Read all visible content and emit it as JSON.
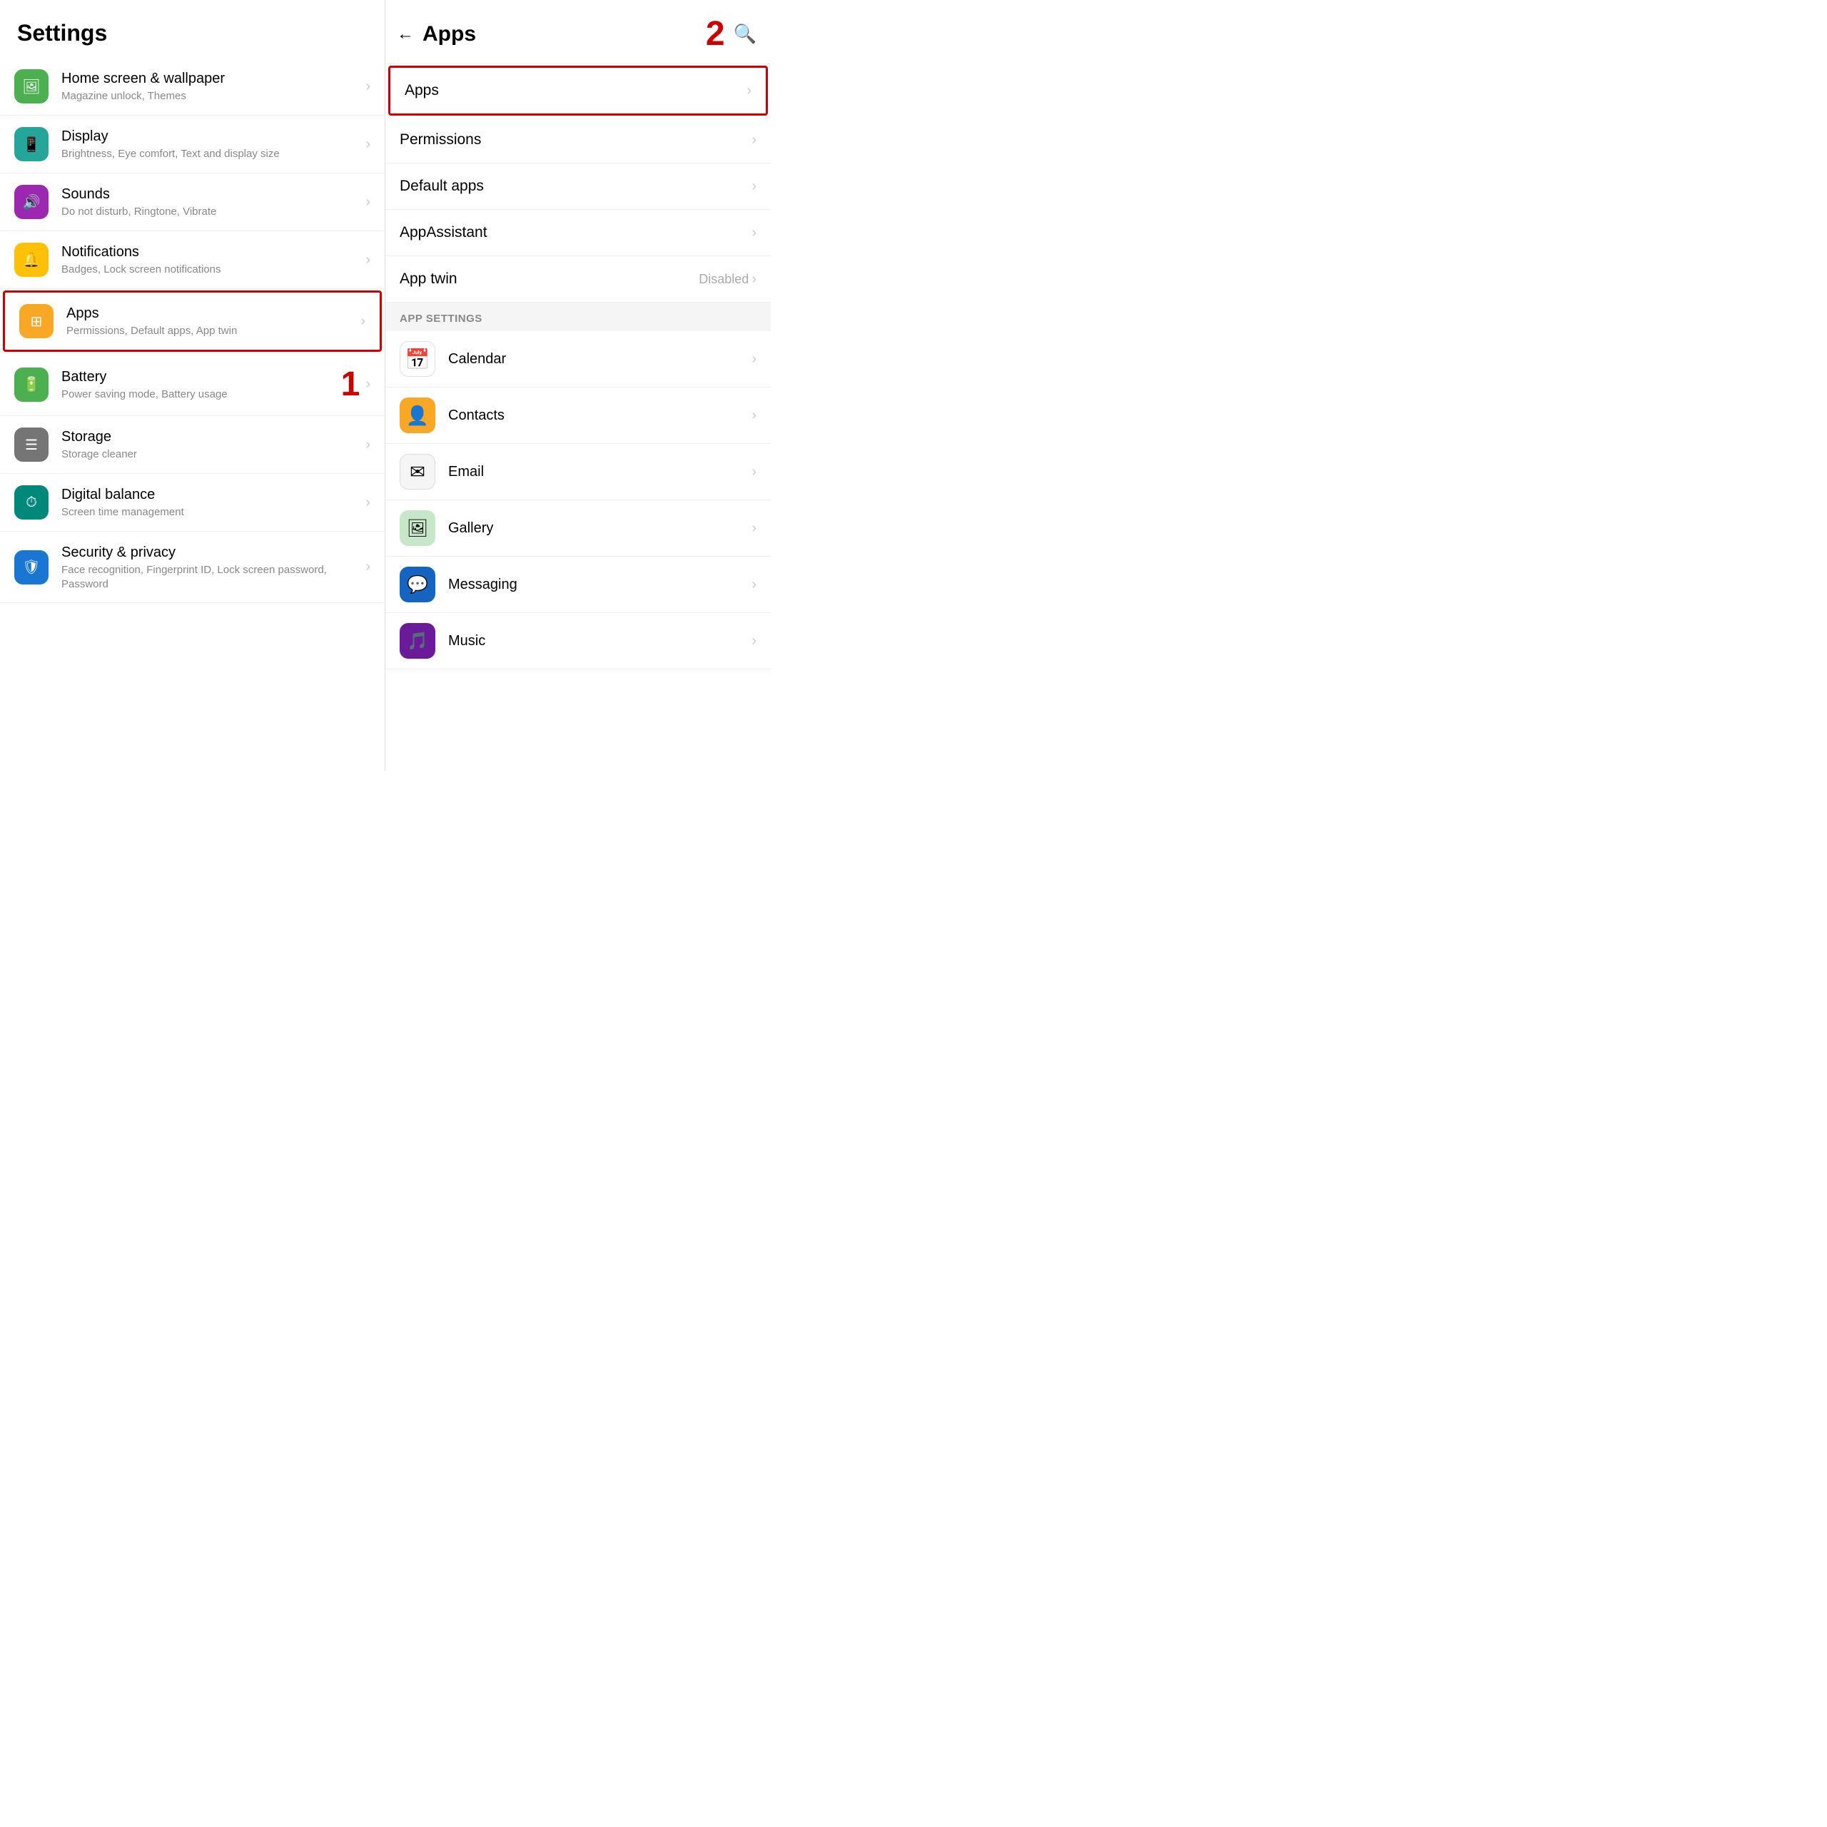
{
  "left": {
    "title": "Settings",
    "items": [
      {
        "icon_color": "icon-green",
        "icon_symbol": "🖼",
        "title": "Home screen & wallpaper",
        "subtitle": "Magazine unlock, Themes"
      },
      {
        "icon_color": "icon-teal",
        "icon_symbol": "📱",
        "title": "Display",
        "subtitle": "Brightness, Eye comfort, Text and display size"
      },
      {
        "icon_color": "icon-purple",
        "icon_symbol": "🔊",
        "title": "Sounds",
        "subtitle": "Do not disturb, Ringtone, Vibrate"
      },
      {
        "icon_color": "icon-yellow",
        "icon_symbol": "🔔",
        "title": "Notifications",
        "subtitle": "Badges, Lock screen notifications"
      },
      {
        "icon_color": "icon-orange-yellow",
        "icon_symbol": "⊞",
        "title": "Apps",
        "subtitle": "Permissions, Default apps, App twin",
        "highlighted": true
      },
      {
        "icon_color": "icon-battery-green",
        "icon_symbol": "🔋",
        "title": "Battery",
        "subtitle": "Power saving mode, Battery usage",
        "show_number": true
      },
      {
        "icon_color": "icon-gray",
        "icon_symbol": "☰",
        "title": "Storage",
        "subtitle": "Storage cleaner"
      },
      {
        "icon_color": "icon-teal-dark",
        "icon_symbol": "⏱",
        "title": "Digital balance",
        "subtitle": "Screen time management"
      },
      {
        "icon_color": "icon-blue-security",
        "icon_symbol": "🛡",
        "title": "Security & privacy",
        "subtitle": "Face recognition, Fingerprint ID, Lock screen password, Password"
      }
    ]
  },
  "right": {
    "title": "Apps",
    "back_label": "←",
    "search_label": "🔍",
    "menu_items": [
      {
        "label": "Apps",
        "value": "",
        "highlighted": true
      },
      {
        "label": "Permissions",
        "value": ""
      },
      {
        "label": "Default apps",
        "value": ""
      },
      {
        "label": "AppAssistant",
        "value": ""
      },
      {
        "label": "App twin",
        "value": "Disabled"
      }
    ],
    "section_header": "APP SETTINGS",
    "app_items": [
      {
        "name": "Calendar",
        "icon_type": "calendar"
      },
      {
        "name": "Contacts",
        "icon_type": "contacts"
      },
      {
        "name": "Email",
        "icon_type": "email"
      },
      {
        "name": "Gallery",
        "icon_type": "gallery"
      },
      {
        "name": "Messaging",
        "icon_type": "messaging"
      },
      {
        "name": "Music",
        "icon_type": "music"
      }
    ]
  },
  "annotation_1": "1",
  "annotation_2": "2"
}
